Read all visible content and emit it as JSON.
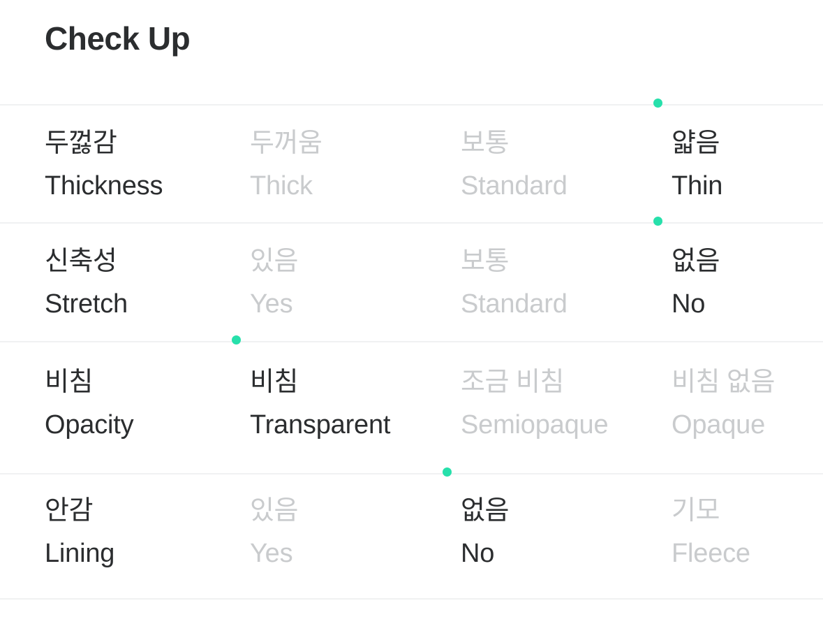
{
  "header": {
    "title": "Check Up"
  },
  "colors": {
    "accent": "#27e0ab",
    "text_active": "#2b2d2f",
    "text_muted": "#c9cbcd",
    "divider": "#f0f1f2",
    "background": "#ffffff"
  },
  "table": {
    "rows": [
      {
        "label": {
          "ko": "두껋감",
          "en": "Thickness"
        },
        "options": [
          {
            "ko": "두꺼움",
            "en": "Thick",
            "selected": false
          },
          {
            "ko": "보통",
            "en": "Standard",
            "selected": false
          },
          {
            "ko": "얇음",
            "en": "Thin",
            "selected": true
          }
        ]
      },
      {
        "label": {
          "ko": "신축성",
          "en": "Stretch"
        },
        "options": [
          {
            "ko": "있음",
            "en": "Yes",
            "selected": false
          },
          {
            "ko": "보통",
            "en": "Standard",
            "selected": false
          },
          {
            "ko": "없음",
            "en": "No",
            "selected": true
          }
        ]
      },
      {
        "label": {
          "ko": "비침",
          "en": "Opacity"
        },
        "options": [
          {
            "ko": "비침",
            "en": "Transparent",
            "selected": true
          },
          {
            "ko": "조금 비침",
            "en": "Semiopaque",
            "selected": false
          },
          {
            "ko": "비침 없음",
            "en": "Opaque",
            "selected": false
          }
        ]
      },
      {
        "label": {
          "ko": "안감",
          "en": "Lining"
        },
        "options": [
          {
            "ko": "있음",
            "en": "Yes",
            "selected": false
          },
          {
            "ko": "없음",
            "en": "No",
            "selected": true
          },
          {
            "ko": "기모",
            "en": "Fleece",
            "selected": false
          }
        ]
      }
    ]
  }
}
